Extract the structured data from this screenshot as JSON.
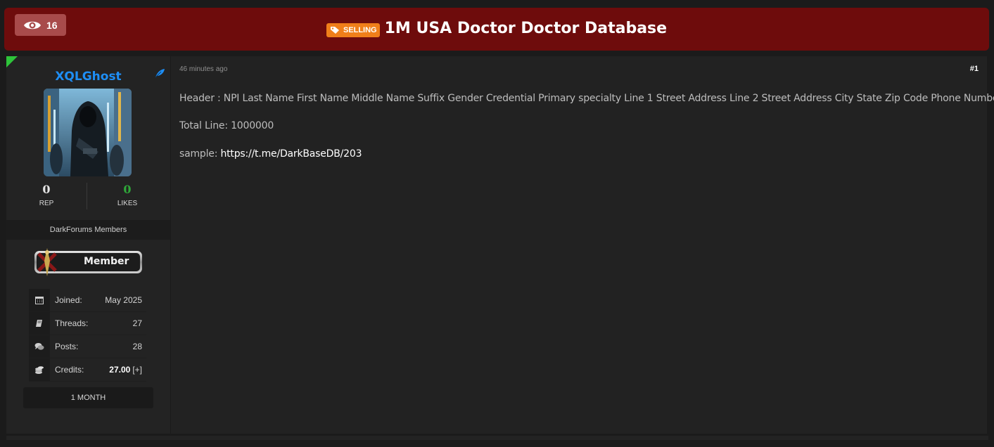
{
  "thread": {
    "views": "16",
    "tag": "SELLING",
    "title": "1M USA Doctor Doctor Database"
  },
  "author": {
    "username": "XQLGhost",
    "rep_value": "0",
    "rep_label": "REP",
    "likes_value": "0",
    "likes_label": "LIKES",
    "group": "DarkForums Members",
    "badge_label": "Member",
    "info": [
      {
        "icon": "calendar-icon",
        "key": "Joined:",
        "value": "May 2025"
      },
      {
        "icon": "book-icon",
        "key": "Threads:",
        "value": "27"
      },
      {
        "icon": "comments-icon",
        "key": "Posts:",
        "value": "28"
      },
      {
        "icon": "coins-icon",
        "key": "Credits:",
        "value": "27.00",
        "extra": "[+]"
      }
    ],
    "duration": "1 MONTH"
  },
  "post": {
    "time": "46 minutes ago",
    "number": "#1",
    "header_line": "Header : NPI  Last Name  First Name  Middle Name  Suffix  Gender  Credential  Primary specialty  Line 1 Street Address  Line 2 Street Address  City  State  Zip Code  Phone Number",
    "total_line": "Total Line: 1000000",
    "sample_label": "sample: ",
    "sample_link": "https://t.me/DarkBaseDB/203"
  },
  "colors": {
    "header_bg": "#6e0c0c",
    "tag_bg": "#f07f1a",
    "username": "#1e8ef5",
    "likes": "#2fa83a",
    "panel_bg": "#232323"
  }
}
